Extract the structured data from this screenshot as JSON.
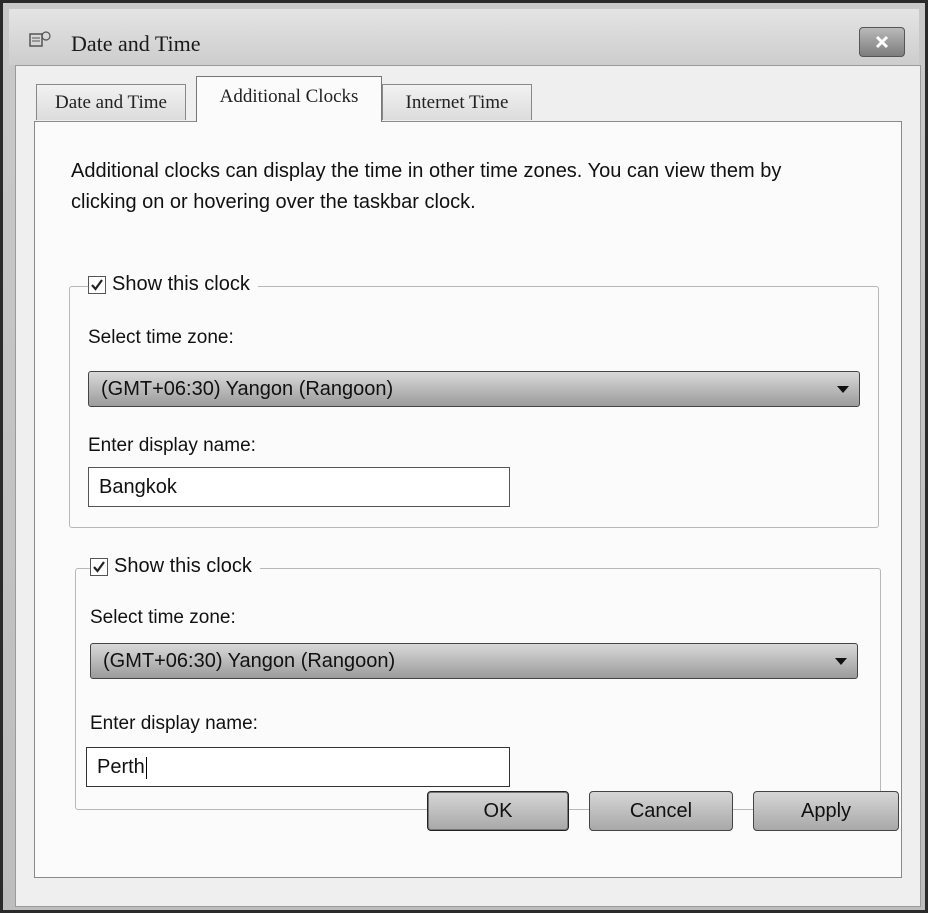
{
  "window": {
    "title": "Date and Time",
    "close_label": "×"
  },
  "tabs": [
    {
      "label": "Date and Time",
      "active": false
    },
    {
      "label": "Additional Clocks",
      "active": true
    },
    {
      "label": "Internet Time",
      "active": false
    }
  ],
  "intro": "Additional clocks can display the time in other time zones. You can view them by clicking on or hovering over the taskbar clock.",
  "clocks": [
    {
      "show_label": "Show this clock",
      "checked": true,
      "timezone_label": "Select time zone:",
      "timezone_value": "(GMT+06:30) Yangon (Rangoon)",
      "name_label": "Enter display name:",
      "name_value": "Bangkok"
    },
    {
      "show_label": "Show this clock",
      "checked": true,
      "timezone_label": "Select time zone:",
      "timezone_value": "(GMT+06:30) Yangon (Rangoon)",
      "name_label": "Enter display name:",
      "name_value": "Perth"
    }
  ],
  "buttons": {
    "ok": "OK",
    "cancel": "Cancel",
    "apply": "Apply"
  }
}
